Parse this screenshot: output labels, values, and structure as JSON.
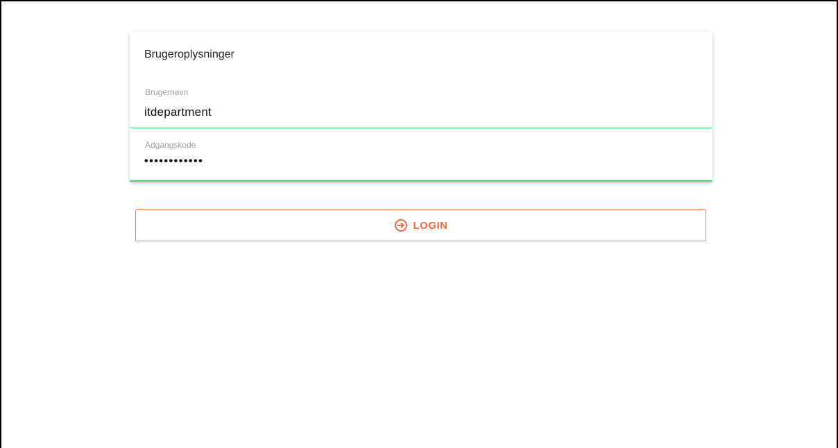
{
  "card": {
    "title": "Brugeroplysninger"
  },
  "username": {
    "label": "Brugernavn",
    "value": "itdepartment"
  },
  "password": {
    "label": "Adgangskode",
    "value": "••••••••••••"
  },
  "login": {
    "label": "LOGIN",
    "icon": "login-icon"
  },
  "colors": {
    "accent": "#f26a3a",
    "focus_underline": "#4cd37a"
  }
}
